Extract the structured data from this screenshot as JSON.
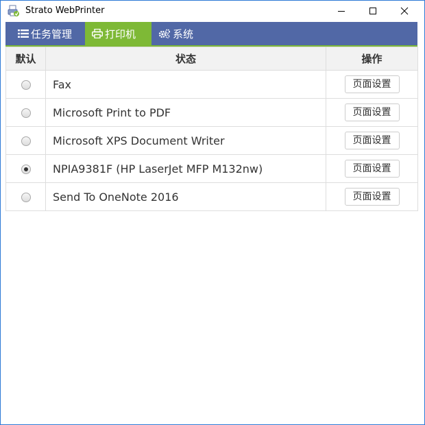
{
  "window": {
    "title": "Strato WebPrinter",
    "controls": [
      "minimize-icon",
      "maximize-icon",
      "close-icon"
    ]
  },
  "nav": {
    "tabs": [
      {
        "label": "任务管理",
        "icon": "list-icon",
        "active": false
      },
      {
        "label": "打印机",
        "icon": "printer-icon",
        "active": true
      },
      {
        "label": "系统",
        "icon": "gears-icon",
        "active": false
      }
    ]
  },
  "table": {
    "headers": {
      "default": "默认",
      "status": "状态",
      "action": "操作"
    },
    "rows": [
      {
        "name": "Fax",
        "default": false,
        "action": "页面设置"
      },
      {
        "name": "Microsoft Print to PDF",
        "default": false,
        "action": "页面设置"
      },
      {
        "name": "Microsoft XPS Document Writer",
        "default": false,
        "action": "页面设置"
      },
      {
        "name": "NPIA9381F (HP LaserJet MFP M132nw)",
        "default": true,
        "action": "页面设置"
      },
      {
        "name": "Send To OneNote 2016",
        "default": false,
        "action": "页面设置"
      }
    ]
  },
  "colors": {
    "nav_bg": "#5168a6",
    "nav_active": "#7eb936",
    "window_border": "#2b79d6"
  }
}
